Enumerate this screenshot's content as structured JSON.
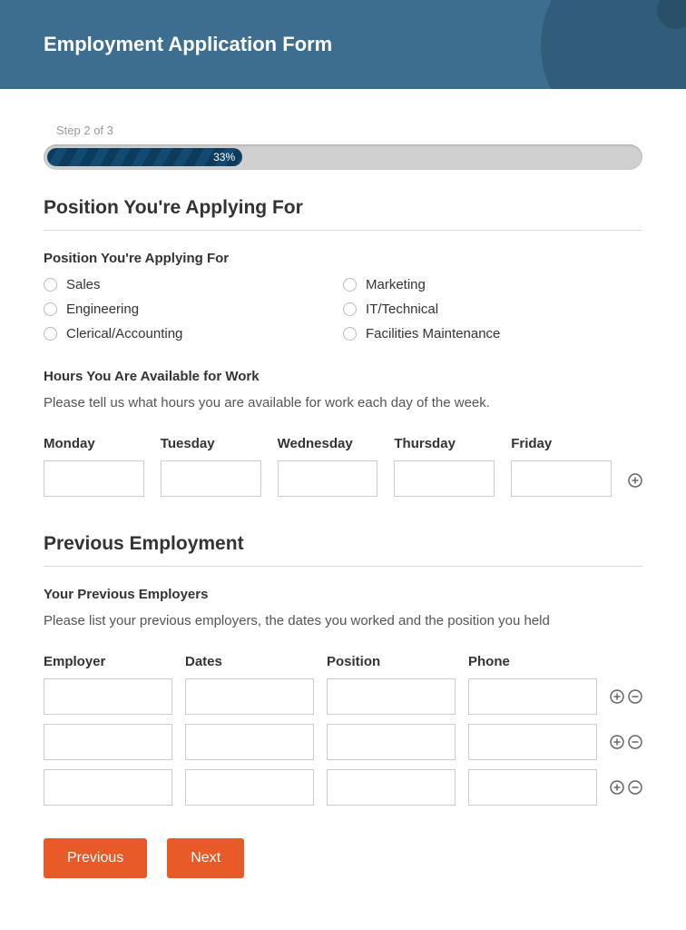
{
  "header": {
    "title": "Employment Application Form"
  },
  "progress": {
    "step_label": "Step 2 of 3",
    "percent": "33%"
  },
  "s1": {
    "title": "Position You're Applying For",
    "pos_label": "Position You're Applying For",
    "options": [
      "Sales",
      "Marketing",
      "Engineering",
      "IT/Technical",
      "Clerical/Accounting",
      "Facilities Maintenance"
    ],
    "hours_label": "Hours You Are Available for Work",
    "hours_help": "Please tell us what hours you are available for work each day of the week.",
    "days": [
      "Monday",
      "Tuesday",
      "Wednesday",
      "Thursday",
      "Friday"
    ]
  },
  "s2": {
    "title": "Previous Employment",
    "prev_label": "Your Previous Employers",
    "prev_help": "Please list your previous employers, the dates you worked and the position you held",
    "cols": [
      "Employer",
      "Dates",
      "Position",
      "Phone"
    ],
    "row_count": 3
  },
  "buttons": {
    "prev": "Previous",
    "next": "Next"
  }
}
